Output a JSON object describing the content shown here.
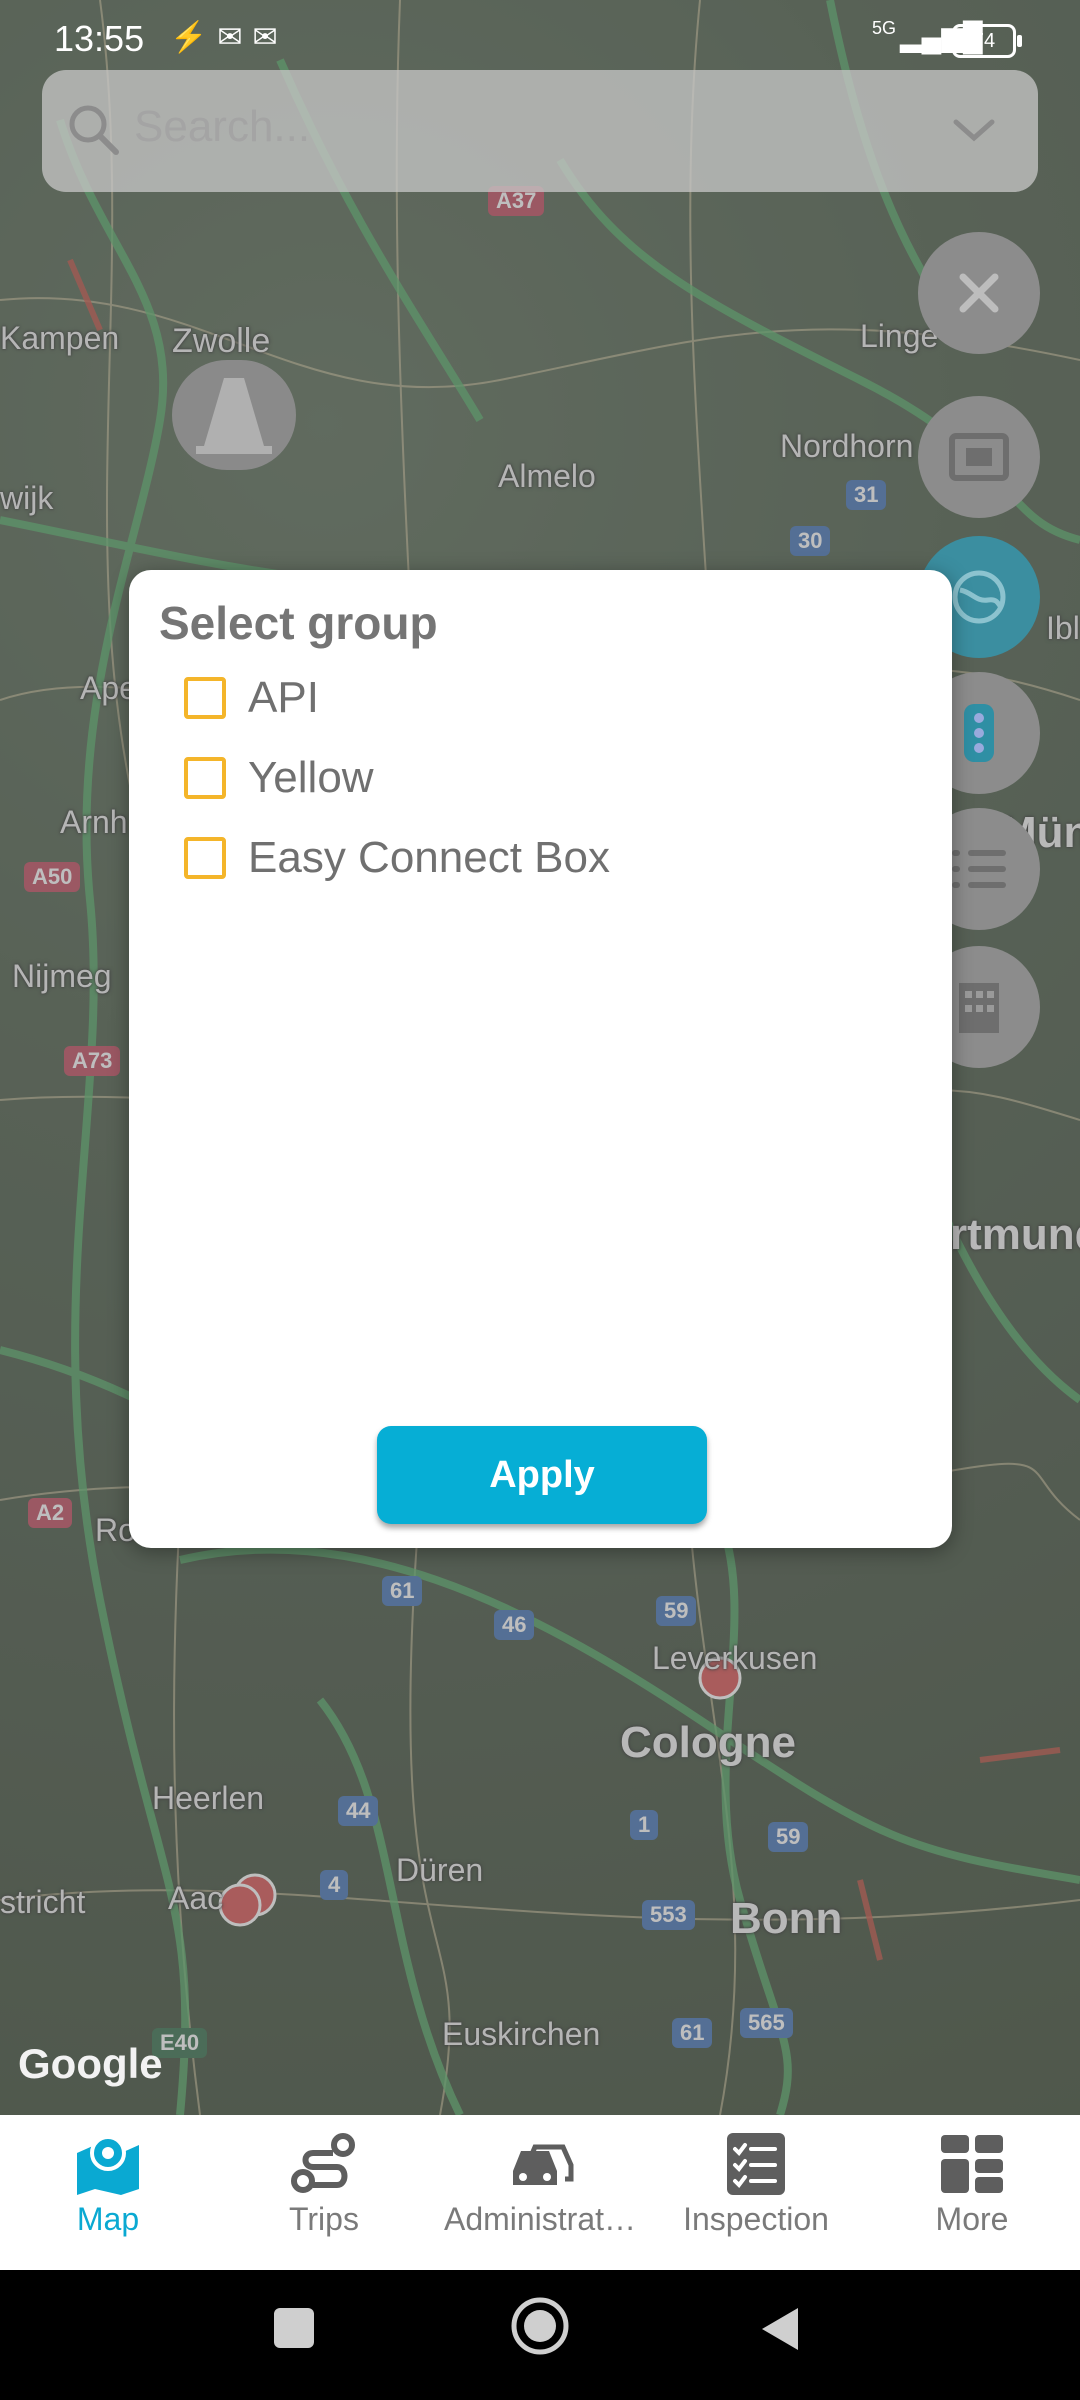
{
  "status_bar": {
    "time": "13:55",
    "notification_icons": [
      "link-icon",
      "mail-icon",
      "mail-icon"
    ],
    "network": "5G",
    "battery": "74"
  },
  "search": {
    "placeholder": "Search..."
  },
  "map": {
    "labels": [
      {
        "id": "kampen",
        "text": "Kampen"
      },
      {
        "id": "zwolle",
        "text": "Zwolle"
      },
      {
        "id": "almelo",
        "text": "Almelo"
      },
      {
        "id": "lingen",
        "text": "Linge"
      },
      {
        "id": "nordhorn",
        "text": "Nordhorn"
      },
      {
        "id": "apel",
        "text": "Ape"
      },
      {
        "id": "arnh",
        "text": "Arnh"
      },
      {
        "id": "nijmeg",
        "text": "Nijmeg"
      },
      {
        "id": "wijk",
        "text": "wijk"
      },
      {
        "id": "ro",
        "text": "Ro"
      },
      {
        "id": "leverkusen",
        "text": "Leverkusen"
      },
      {
        "id": "cologne",
        "text": "Cologne"
      },
      {
        "id": "heerlen",
        "text": "Heerlen"
      },
      {
        "id": "aac",
        "text": "Aac"
      },
      {
        "id": "duren",
        "text": "Düren"
      },
      {
        "id": "bonn",
        "text": "Bonn"
      },
      {
        "id": "euskirchen",
        "text": "Euskirchen"
      },
      {
        "id": "stricht",
        "text": "stricht"
      },
      {
        "id": "rtmund",
        "text": "rtmund"
      },
      {
        "id": "mun",
        "text": "Mün"
      },
      {
        "id": "ibl",
        "text": "Ibl"
      }
    ],
    "road_shields": [
      {
        "id": "a37",
        "text": "A37"
      },
      {
        "id": "a50",
        "text": "A50"
      },
      {
        "id": "a73",
        "text": "A73"
      },
      {
        "id": "a2",
        "text": "A2"
      },
      {
        "id": "r31",
        "text": "31"
      },
      {
        "id": "r30",
        "text": "30"
      },
      {
        "id": "r61a",
        "text": "61"
      },
      {
        "id": "r46",
        "text": "46"
      },
      {
        "id": "r59a",
        "text": "59"
      },
      {
        "id": "r44",
        "text": "44"
      },
      {
        "id": "r1",
        "text": "1"
      },
      {
        "id": "r59b",
        "text": "59"
      },
      {
        "id": "r4",
        "text": "4"
      },
      {
        "id": "r553",
        "text": "553"
      },
      {
        "id": "r565",
        "text": "565"
      },
      {
        "id": "r61b",
        "text": "61"
      },
      {
        "id": "e40",
        "text": "E40"
      }
    ],
    "attribution": "Google"
  },
  "dialog": {
    "title": "Select group",
    "options": [
      {
        "label": "API",
        "checked": false
      },
      {
        "label": "Yellow",
        "checked": false
      },
      {
        "label": "Easy Connect Box",
        "checked": false
      }
    ],
    "apply_label": "Apply"
  },
  "fabs": [
    "close-icon",
    "screen-frame-icon",
    "globe-icon",
    "traffic-light-icon",
    "list-icon",
    "building-icon"
  ],
  "tabs": [
    {
      "label": "Map",
      "icon": "map-pin-icon",
      "active": true
    },
    {
      "label": "Trips",
      "icon": "route-icon",
      "active": false
    },
    {
      "label": "Administrat…",
      "icon": "cars-icon",
      "active": false
    },
    {
      "label": "Inspection",
      "icon": "checklist-icon",
      "active": false
    },
    {
      "label": "More",
      "icon": "grid-icon",
      "active": false
    }
  ],
  "colors": {
    "accent": "#06aed5",
    "checkbox": "#f4b52a",
    "tab_active": "#0aa9d2"
  }
}
